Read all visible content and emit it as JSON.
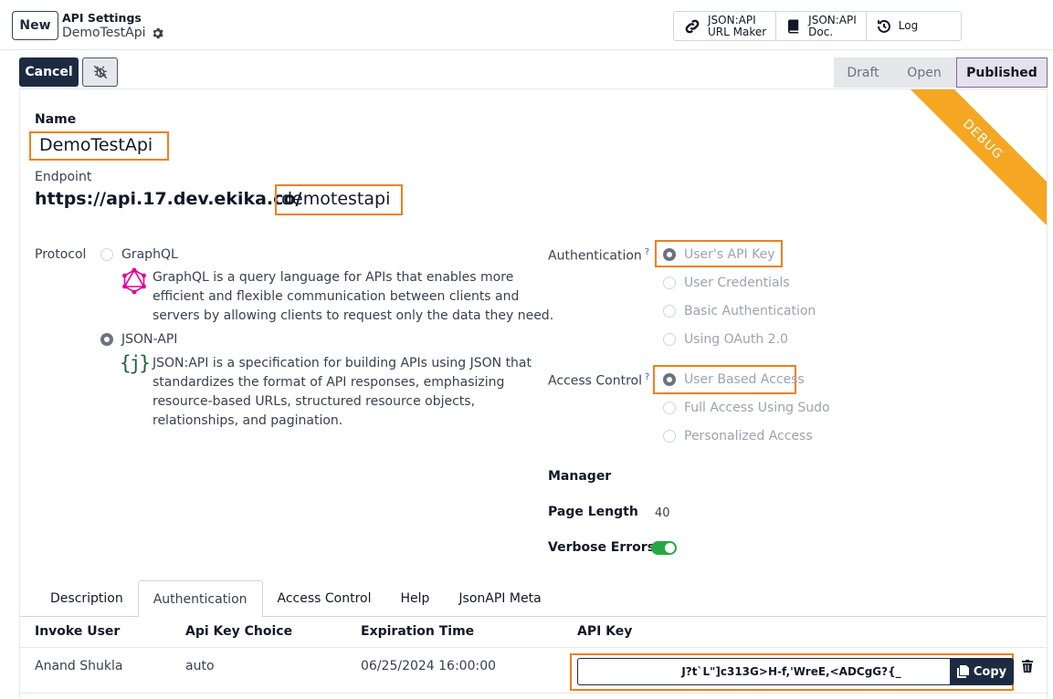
{
  "topbar": {
    "new_label": "New",
    "breadcrumb_parent": "API Settings",
    "breadcrumb_current": "DemoTestApi",
    "buttons": [
      {
        "label_line1": "JSON:API",
        "label_line2": "URL Maker",
        "icon": "link-icon"
      },
      {
        "label_line1": "JSON:API",
        "label_line2": "Doc.",
        "icon": "book-icon"
      },
      {
        "label_line1": "Log",
        "label_line2": "",
        "icon": "history-icon"
      }
    ]
  },
  "controls": {
    "cancel_label": "Cancel",
    "debug_icon": "bug-slash-icon",
    "stages": [
      {
        "label": "Draft",
        "active": false
      },
      {
        "label": "Open",
        "active": false
      },
      {
        "label": "Published",
        "active": true
      }
    ]
  },
  "form": {
    "ribbon": "DEBUG",
    "name_label": "Name",
    "name_value": "DemoTestApi",
    "endpoint_label": "Endpoint",
    "endpoint_base": "https://api.17.dev.ekika.co/",
    "endpoint_path": "demotestapi",
    "protocol_label": "Protocol",
    "protocols": [
      {
        "label": "GraphQL",
        "selected": false,
        "icon": "graphql-icon",
        "description_lines": [
          "GraphQL is a query language for APIs that enables more",
          "efficient and flexible communication between clients and",
          "servers by allowing clients to request only the data they need."
        ]
      },
      {
        "label": "JSON-API",
        "selected": true,
        "icon": "json-braces-icon",
        "icon_text": "{j}",
        "description_lines": [
          "JSON:API is a specification for building APIs using JSON that",
          "standardizes the format of API responses, emphasizing",
          "resource-based URLs, structured resource objects,",
          "relationships, and pagination."
        ]
      }
    ],
    "authentication_label": "Authentication",
    "help_marker": "?",
    "authentication_options": [
      {
        "label": "User's API Key",
        "selected": true
      },
      {
        "label": "User Credentials",
        "selected": false
      },
      {
        "label": "Basic Authentication",
        "selected": false
      },
      {
        "label": "Using OAuth 2.0",
        "selected": false
      }
    ],
    "access_control_label": "Access Control",
    "access_control_options": [
      {
        "label": "User Based Access",
        "selected": true
      },
      {
        "label": "Full Access Using Sudo",
        "selected": false
      },
      {
        "label": "Personalized Access",
        "selected": false
      }
    ],
    "manager_label": "Manager",
    "manager_value": "",
    "page_length_label": "Page Length",
    "page_length_value": "40",
    "verbose_errors_label": "Verbose Errors",
    "verbose_errors_on": true
  },
  "tabs": [
    {
      "label": "Description",
      "active": false
    },
    {
      "label": "Authentication",
      "active": true
    },
    {
      "label": "Access Control",
      "active": false
    },
    {
      "label": "Help",
      "active": false
    },
    {
      "label": "JsonAPI Meta",
      "active": false
    }
  ],
  "table": {
    "headers": [
      "Invoke User",
      "Api Key Choice",
      "Expiration Time",
      "API Key"
    ],
    "rows": [
      {
        "invoke_user": "Anand Shukla",
        "api_key_choice": "auto",
        "expiration_time": "06/25/2024 16:00:00",
        "api_key": "J?t`L\"]c313G>H-f,'WreE,<ADCgG?{_",
        "copy_label": "Copy"
      }
    ]
  },
  "colors": {
    "primary": "#1c2b42",
    "highlight": "#f07f1e",
    "ribbon": "#f5a623",
    "toggle_on": "#28a745",
    "graphql": "#e10098",
    "json_icon": "#1f5f3f"
  }
}
